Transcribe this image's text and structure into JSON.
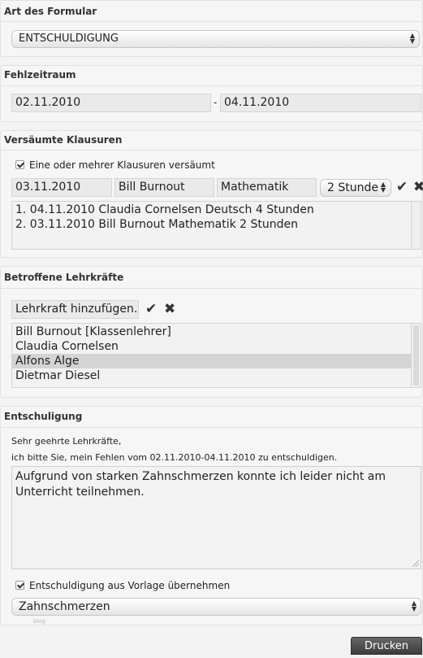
{
  "form_type": {
    "title": "Art des Formular",
    "selected": "ENTSCHULDIGUNG"
  },
  "absence_period": {
    "title": "Fehlzeitraum",
    "from": "02.11.2010",
    "separator": "-",
    "to": "04.11.2010"
  },
  "missed_exams": {
    "title": "Versäumte Klausuren",
    "checkbox_label": "Eine oder mehrer Klausuren versäumt",
    "checked": true,
    "date": "03.11.2010",
    "teacher": "Bill Burnout",
    "subject": "Mathematik",
    "duration": "2 Stunden",
    "list": [
      "1. 04.11.2010 Claudia Cornelsen Deutsch 4 Stunden",
      "2. 03.11.2010 Bill Burnout Mathematik 2 Stunden"
    ]
  },
  "teachers": {
    "title": "Betroffene Lehrkräfte",
    "add_field": "Lehrkraft hinzufügen...",
    "items": [
      "Bill Burnout [Klassenlehrer]",
      "Claudia Cornelsen",
      "Alfons Alge",
      "Dietmar Diesel"
    ],
    "selected_index": 2
  },
  "excuse": {
    "title": "Entschuligung",
    "greeting": "Sehr geehrte Lehrkräfte,",
    "intro": "ich bitte Sie, mein Fehlen vom 02.11.2010-04.11.2010 zu entschuldigen.",
    "body_text": "Aufgrund von starken Zahnschmerzen konnte ich leider nicht am Unterricht teilnehmen.",
    "template_checkbox_label": "Entschuldigung aus Vorlage übernehmen",
    "template_checked": true,
    "template_selected": "Zahnschmerzen",
    "watermark": "blog"
  },
  "footer": {
    "print_label": "Drucken"
  },
  "colors": {
    "background": "#f3f3f3",
    "selected_row": "#d4d4d4",
    "print_button": "#4a4a4a"
  }
}
